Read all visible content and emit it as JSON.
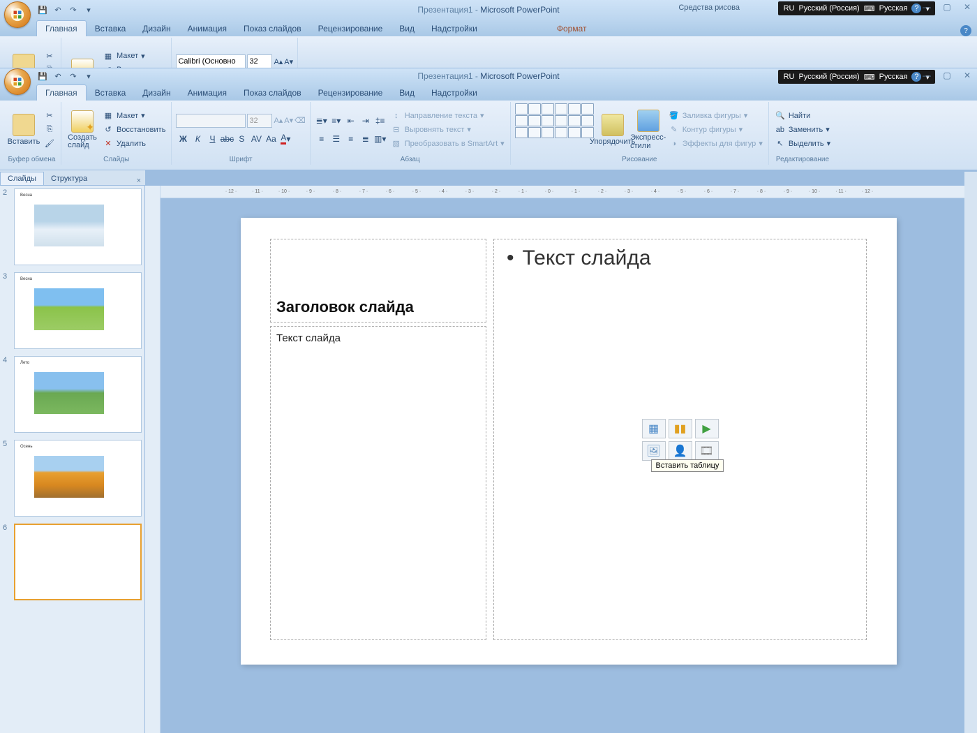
{
  "app": {
    "doc_title": "Презентация1",
    "app_name": "Microsoft PowerPoint",
    "drawing_tools": "Средства рисова",
    "format_tab": "Формат"
  },
  "lang_tray": {
    "code": "RU",
    "lang": "Русский (Россия)",
    "layout": "Русская"
  },
  "tabs": {
    "home": "Главная",
    "insert": "Вставка",
    "design": "Дизайн",
    "animation": "Анимация",
    "slideshow": "Показ слайдов",
    "review": "Рецензирование",
    "view": "Вид",
    "addins": "Надстройки"
  },
  "ribbon": {
    "clipboard": {
      "label": "Буфер обмена",
      "paste": "Вставить"
    },
    "slides": {
      "label": "Слайды",
      "new": "Создать\nслайд",
      "layout": "Макет",
      "reset": "Восстановить",
      "delete": "Удалить"
    },
    "font": {
      "label": "Шрифт",
      "name": "Calibri (Основно",
      "size": "32"
    },
    "paragraph": {
      "label": "Абзац",
      "textdir": "Направление текста",
      "align": "Выровнять текст",
      "smartart": "Преобразовать в SmartArt"
    },
    "drawing": {
      "label": "Рисование",
      "arrange": "Упорядочить",
      "styles": "Экспресс-стили",
      "fill": "Заливка фигуры",
      "outline": "Контур фигуры",
      "effects": "Эффекты для фигур"
    },
    "editing": {
      "label": "Редактирование",
      "find": "Найти",
      "replace": "Заменить",
      "select": "Выделить"
    }
  },
  "outline_tabs": {
    "slides": "Слайды",
    "outline": "Структура"
  },
  "thumbs": [
    {
      "num": "2",
      "title": "Весна"
    },
    {
      "num": "3",
      "title": "Весна"
    },
    {
      "num": "4",
      "title": "Лето"
    },
    {
      "num": "5",
      "title": "Осень"
    },
    {
      "num": "6",
      "title": ""
    }
  ],
  "slide": {
    "title_ph": "Заголовок слайда",
    "sub_ph": "Текст слайда",
    "content_ph": "Текст слайда",
    "tooltip": "Вставить таблицу"
  },
  "ruler_marks": [
    "12",
    "11",
    "10",
    "9",
    "8",
    "7",
    "6",
    "5",
    "4",
    "3",
    "2",
    "1",
    "0",
    "1",
    "2",
    "3",
    "4",
    "5",
    "6",
    "7",
    "8",
    "9",
    "10",
    "11",
    "12"
  ]
}
